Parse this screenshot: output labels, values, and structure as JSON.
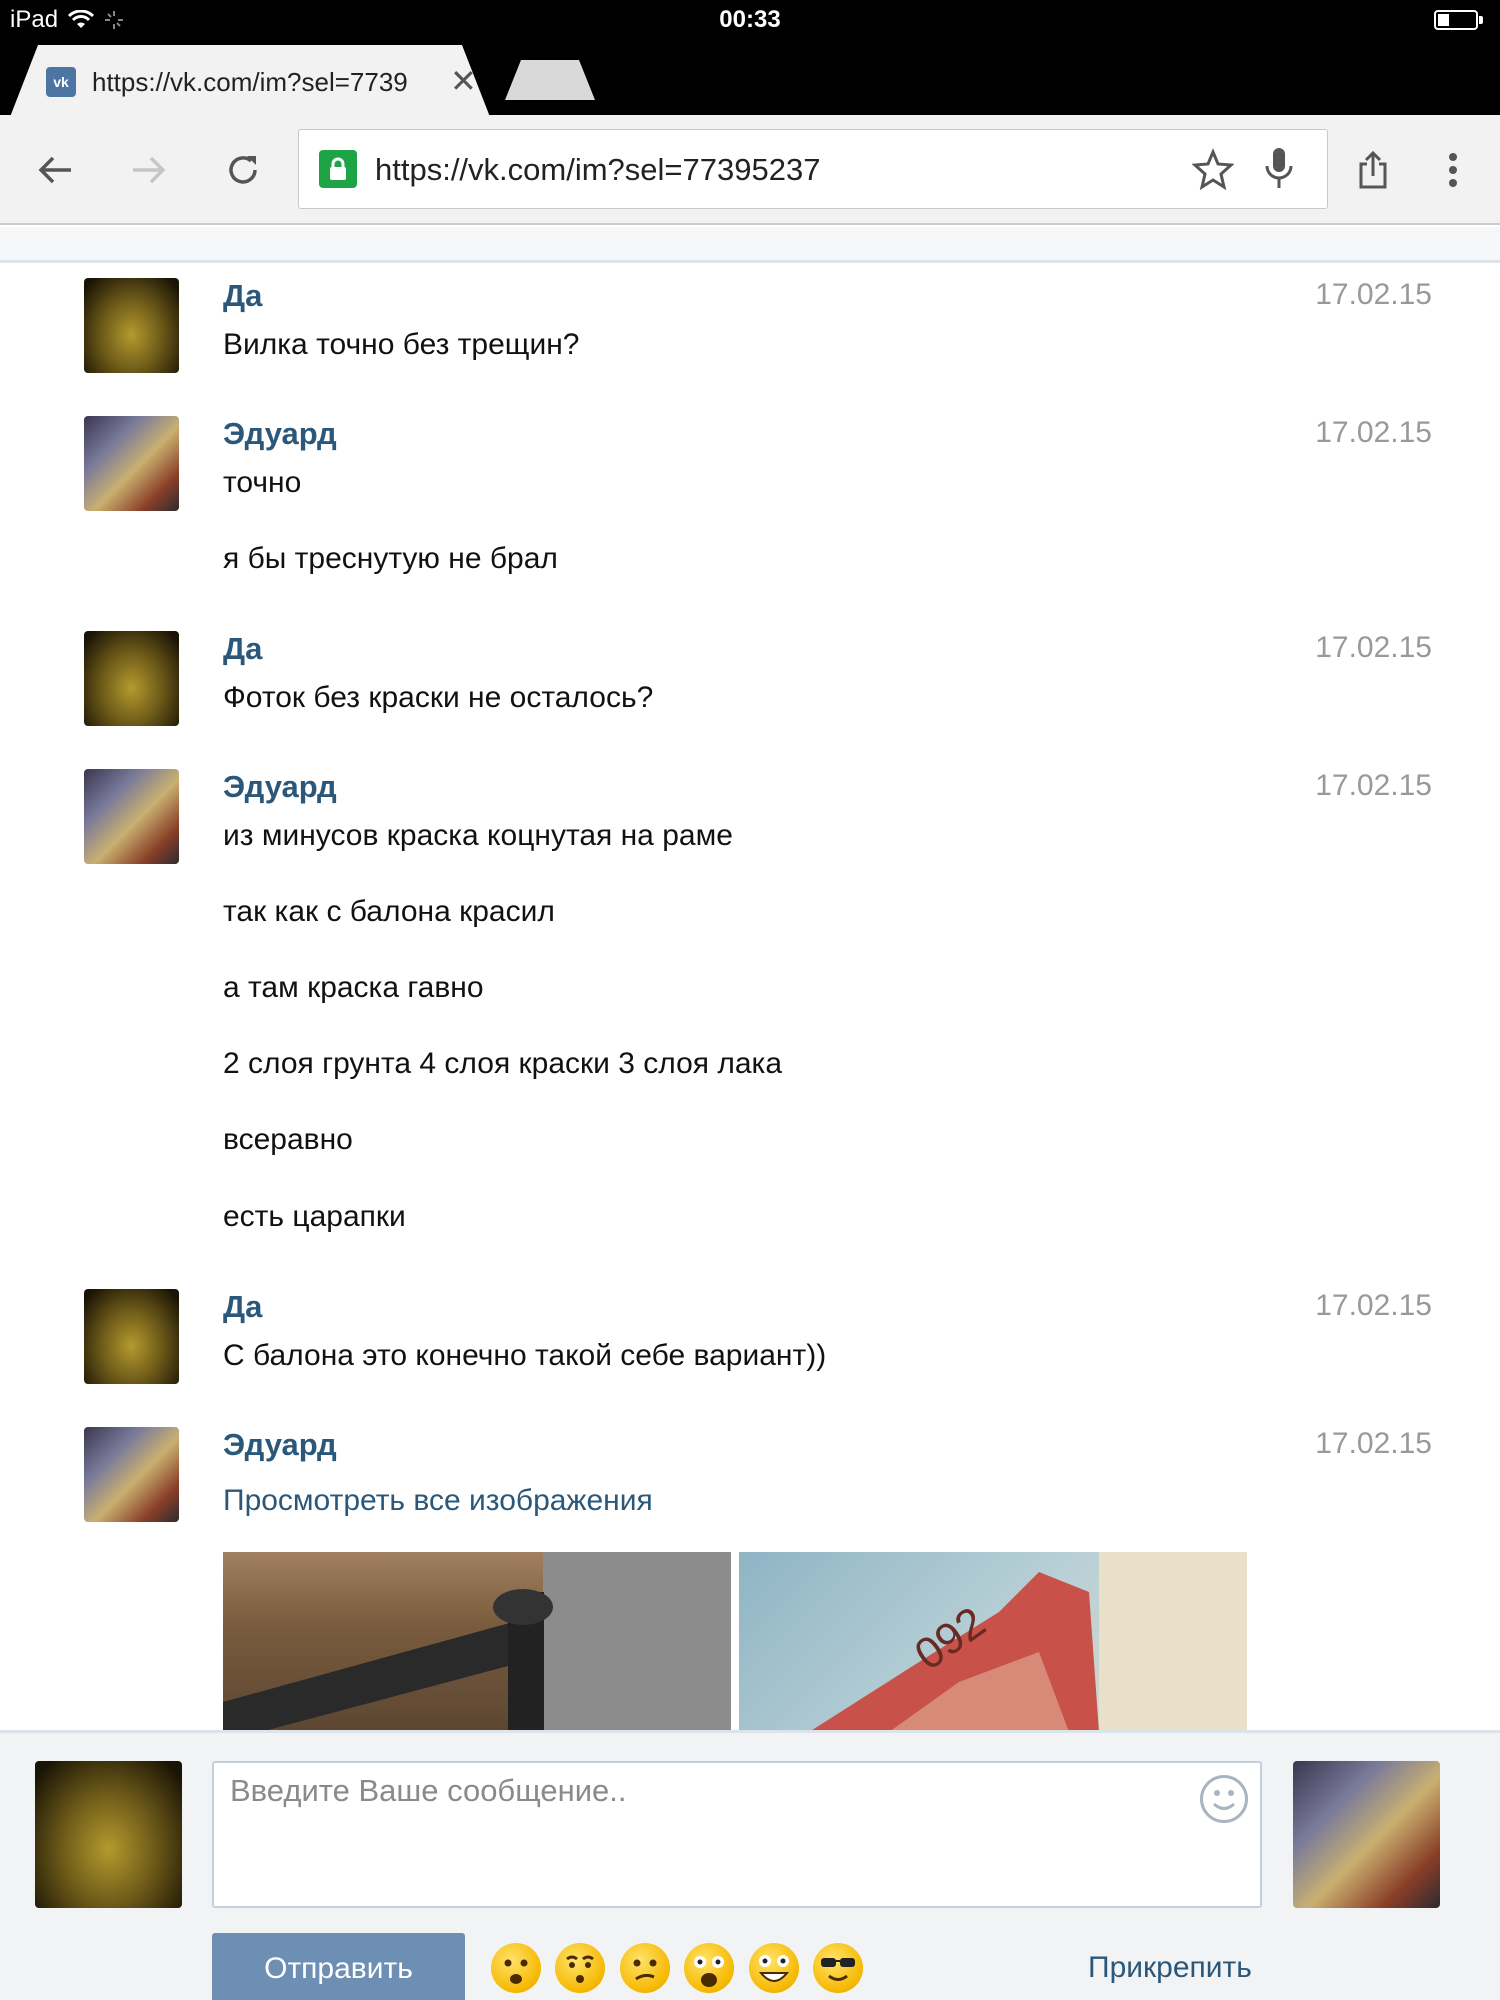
{
  "status_bar": {
    "device": "iPad",
    "time": "00:33",
    "battery_level": 0.3
  },
  "browser": {
    "tab_title": "https://vk.com/im?sel=7739",
    "tab_favicon": "vk-icon",
    "url": "https://vk.com/im?sel=77395237",
    "icons": [
      "back-icon",
      "forward-icon",
      "reload-icon",
      "lock-icon",
      "star-icon",
      "mic-icon",
      "share-icon",
      "menu-icon"
    ]
  },
  "messages": [
    {
      "author": "Да",
      "date": "17.02.15",
      "lines": [
        "Вилка точно без трещин?"
      ],
      "avatar": "da"
    },
    {
      "author": "Эдуард",
      "date": "17.02.15",
      "lines": [
        "точно",
        "я бы треснутую не брал"
      ],
      "avatar": "ed"
    },
    {
      "author": "Да",
      "date": "17.02.15",
      "lines": [
        "Фоток без краски не осталось?"
      ],
      "avatar": "da"
    },
    {
      "author": "Эдуард",
      "date": "17.02.15",
      "lines": [
        "из минусов краска коцнутая на раме",
        "так как с балона красил",
        "а там краска гавно",
        "2 слоя грунта 4 слоя краски 3 слоя лака",
        "всеравно",
        "есть царапки"
      ],
      "avatar": "ed"
    },
    {
      "author": "Да",
      "date": "17.02.15",
      "lines": [
        "С балона это конечно такой себе вариант))"
      ],
      "avatar": "da"
    },
    {
      "author": "Эдуард",
      "date": "17.02.15",
      "link": "Просмотреть все изображения",
      "avatar": "ed",
      "photo_stamp": "092"
    }
  ],
  "compose": {
    "placeholder": "Введите Ваше сообщение..",
    "send_label": "Отправить",
    "attach_label": "Прикрепить",
    "emojis": [
      "frowning-emoji",
      "hushed-emoji",
      "confused-emoji",
      "screaming-emoji",
      "grinning-emoji",
      "sunglasses-emoji"
    ]
  },
  "colors": {
    "vk_blue": "#2b587a",
    "send_button": "#6d8fb3",
    "lock_green": "#1ea446"
  }
}
